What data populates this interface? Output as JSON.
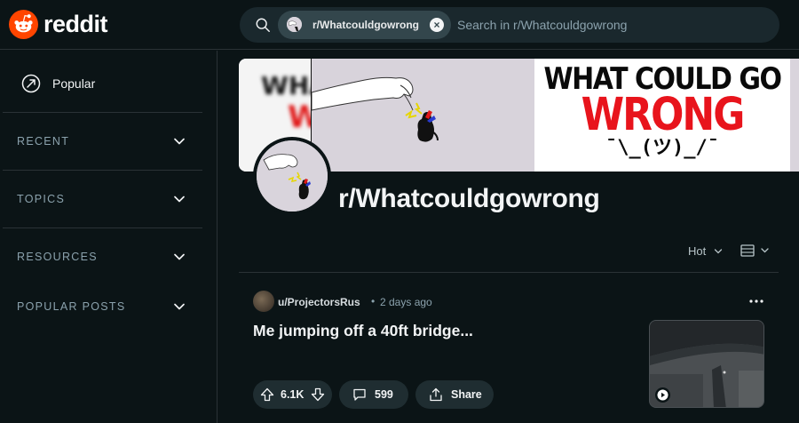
{
  "header": {
    "brand": "reddit",
    "search": {
      "chip_label": "r/Whatcouldgowrong",
      "placeholder": "Search in r/Whatcouldgowrong"
    }
  },
  "sidebar": {
    "popular_label": "Popular",
    "sections": [
      {
        "label": "RECENT"
      },
      {
        "label": "TOPICS"
      },
      {
        "label": "RESOURCES"
      },
      {
        "label": "POPULAR POSTS"
      }
    ]
  },
  "banner": {
    "line1": "WHAT COULD GO",
    "line2": "WRONG",
    "line3": "¯\\_(ツ)_/¯",
    "blur_top": "WHA",
    "blur_bottom": "W"
  },
  "subreddit": {
    "name": "r/Whatcouldgowrong"
  },
  "feed_controls": {
    "sort_label": "Hot",
    "view_icon": "card-view-icon"
  },
  "post": {
    "author": "u/ProjectorsRus",
    "separator": "•",
    "time": "2 days ago",
    "title": "Me jumping off a 40ft bridge...",
    "votes": "6.1K",
    "comments": "599",
    "share_label": "Share"
  },
  "colors": {
    "background": "#0b1416",
    "reddit_orange": "#ff4500",
    "wrong_red": "#e8141c",
    "pill_bg": "#1f2d31"
  }
}
